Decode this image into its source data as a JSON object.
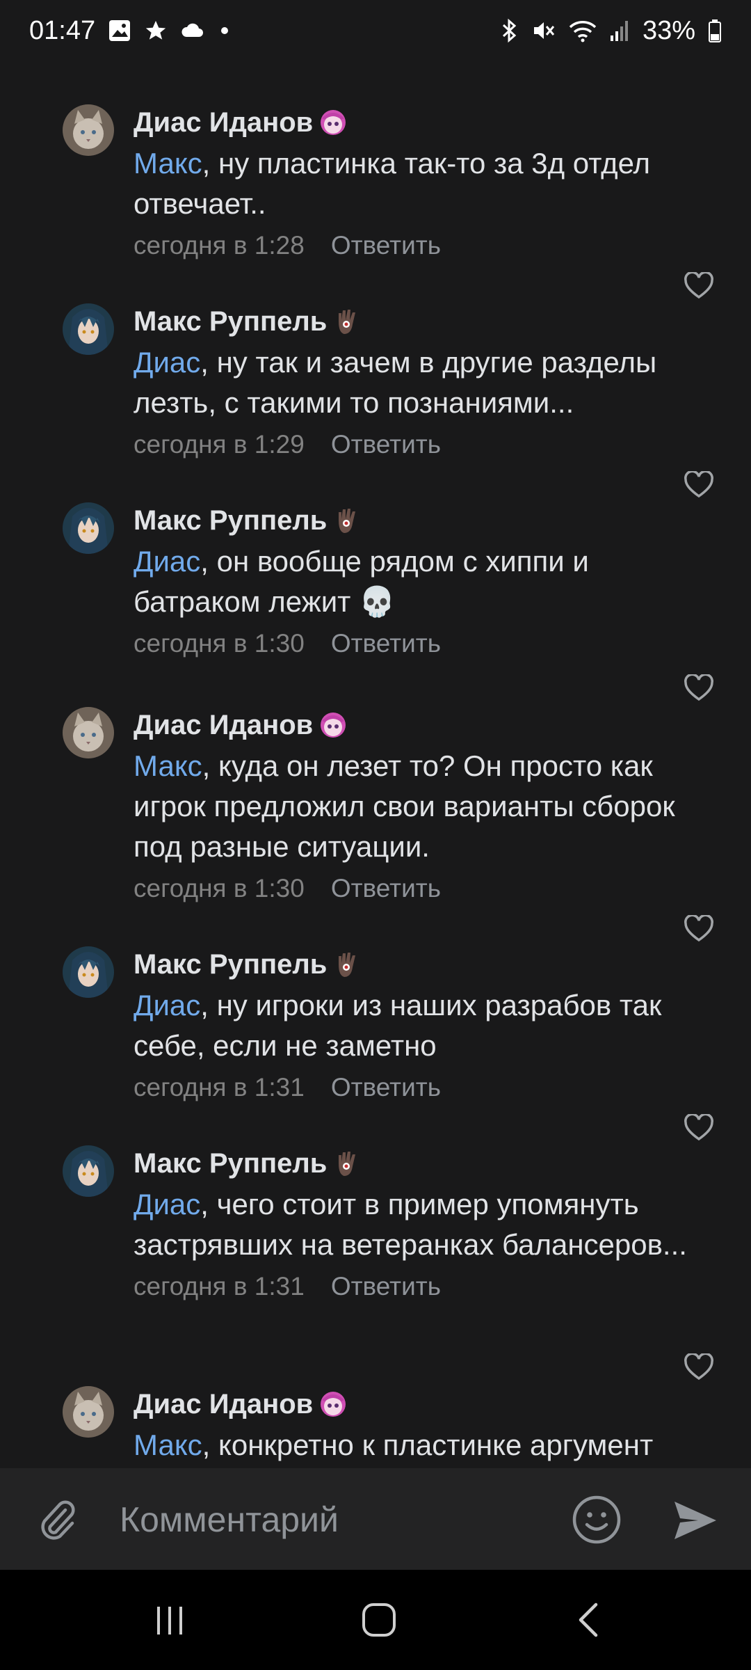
{
  "status_bar": {
    "time": "01:47",
    "battery": "33%",
    "left_icons": [
      "gallery-icon",
      "star-icon",
      "cloud-icon",
      "dot-icon"
    ],
    "right_icons": [
      "bluetooth-icon",
      "mute-icon",
      "wifi-icon",
      "signal-icon",
      "battery-icon"
    ]
  },
  "comments": [
    {
      "author": "Диас Иданов",
      "author_emoji": "anime-girl-emoji",
      "avatar": "cat-avatar",
      "mention": "Макс",
      "text": ", ну пластинка так-то за 3д отдел отвечает..",
      "time": "сегодня в 1:28",
      "reply_label": "Ответить"
    },
    {
      "author": "Макс Руппель",
      "author_emoji": "hand-eye-emoji",
      "avatar": "anime-avatar",
      "mention": "Диас",
      "text": ", ну так и зачем в другие разделы лезть, с такими то познаниями...",
      "time": "сегодня в 1:29",
      "reply_label": "Ответить"
    },
    {
      "author": "Макс Руппель",
      "author_emoji": "hand-eye-emoji",
      "avatar": "anime-avatar",
      "mention": "Диас",
      "text": ", он вообще рядом с хиппи и батраком лежит 💀",
      "time": "сегодня в 1:30",
      "reply_label": "Ответить"
    },
    {
      "author": "Диас Иданов",
      "author_emoji": "anime-girl-emoji",
      "avatar": "cat-avatar",
      "mention": "Макс",
      "text": ", куда он лезет то? Он просто как игрок предложил свои варианты сборок под разные ситуации.",
      "time": "сегодня в 1:30",
      "reply_label": "Ответить"
    },
    {
      "author": "Макс Руппель",
      "author_emoji": "hand-eye-emoji",
      "avatar": "anime-avatar",
      "mention": "Диас",
      "text": ", ну игроки из наших разрабов так себе, если не заметно",
      "time": "сегодня в 1:31",
      "reply_label": "Ответить"
    },
    {
      "author": "Макс Руппель",
      "author_emoji": "hand-eye-emoji",
      "avatar": "anime-avatar",
      "mention": "Диас",
      "text": ", чего стоит в пример упомянуть застрявших на ветеранках балансеров...",
      "time": "сегодня в 1:31",
      "reply_label": "Ответить"
    },
    {
      "author": "Диас Иданов",
      "author_emoji": "anime-girl-emoji",
      "avatar": "cat-avatar",
      "mention": "Макс",
      "text": ", конкретно к пластинке аргумент",
      "time": "",
      "reply_label": ""
    }
  ],
  "composer": {
    "placeholder": "Комментарий",
    "attach_icon": "paperclip-icon",
    "emoji_icon": "smiley-icon",
    "send_icon": "send-icon"
  },
  "nav_bar": {
    "icons": [
      "recent-apps-icon",
      "home-icon",
      "back-icon"
    ]
  },
  "colors": {
    "background": "#19191a",
    "text": "#e1e3e6",
    "mention": "#71aaeb",
    "meta": "#828282",
    "composer_bg": "#232324"
  }
}
